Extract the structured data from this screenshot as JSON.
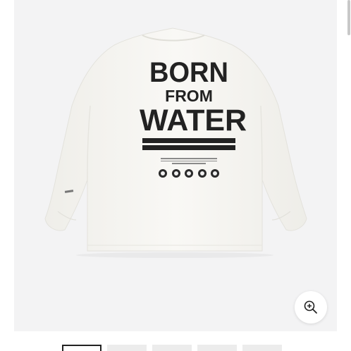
{
  "product": {
    "print_text": {
      "line1": "BORN",
      "line2": "FROM",
      "line3": "WATER"
    },
    "logos": [
      "brand-logo-1",
      "brand-logo-2",
      "brand-logo-3",
      "brand-logo-4",
      "brand-logo-5"
    ],
    "colors": {
      "shirt": "#f7f6f2",
      "print": "#222222",
      "background": "#f3f3f4"
    }
  },
  "controls": {
    "zoom_icon": "zoom-in-icon"
  },
  "gallery": {
    "thumbnail_count": 5,
    "active_index": 0
  }
}
